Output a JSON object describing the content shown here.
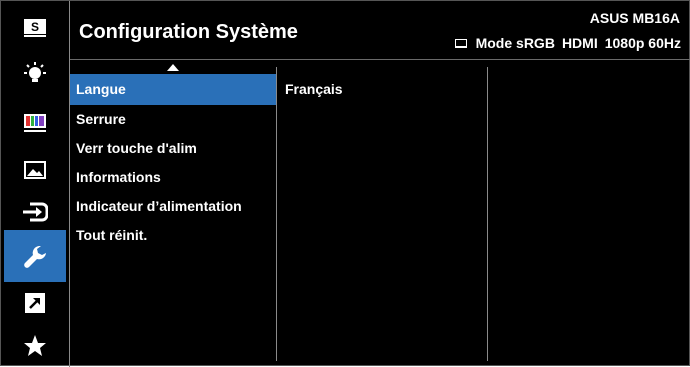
{
  "header": {
    "title": "Configuration Système",
    "model": "ASUS MB16A",
    "status": {
      "mode": "Mode sRGB",
      "input": "HDMI",
      "resolution": "1080p 60Hz"
    }
  },
  "sidebar": {
    "items": [
      {
        "name": "splendid-icon",
        "label": "S",
        "active": false
      },
      {
        "name": "blue-light-icon",
        "active": false
      },
      {
        "name": "color-icon",
        "active": false
      },
      {
        "name": "image-icon",
        "active": false
      },
      {
        "name": "input-select-icon",
        "active": false
      },
      {
        "name": "system-setup-icon",
        "active": true
      },
      {
        "name": "shortcut-icon",
        "active": false
      },
      {
        "name": "favorite-icon",
        "active": false
      }
    ]
  },
  "menu": {
    "items": [
      {
        "label": "Langue",
        "selected": true
      },
      {
        "label": "Serrure",
        "selected": false
      },
      {
        "label": "Verr touche d'alim",
        "selected": false
      },
      {
        "label": "Informations",
        "selected": false
      },
      {
        "label": "Indicateur d’alimentation",
        "selected": false
      },
      {
        "label": "Tout réinit.",
        "selected": false
      }
    ]
  },
  "value_panel": {
    "current": "Français"
  },
  "colors": {
    "accent": "#2a70b8",
    "background": "#000000",
    "text": "#ffffff",
    "divider": "#8a8a8a"
  }
}
